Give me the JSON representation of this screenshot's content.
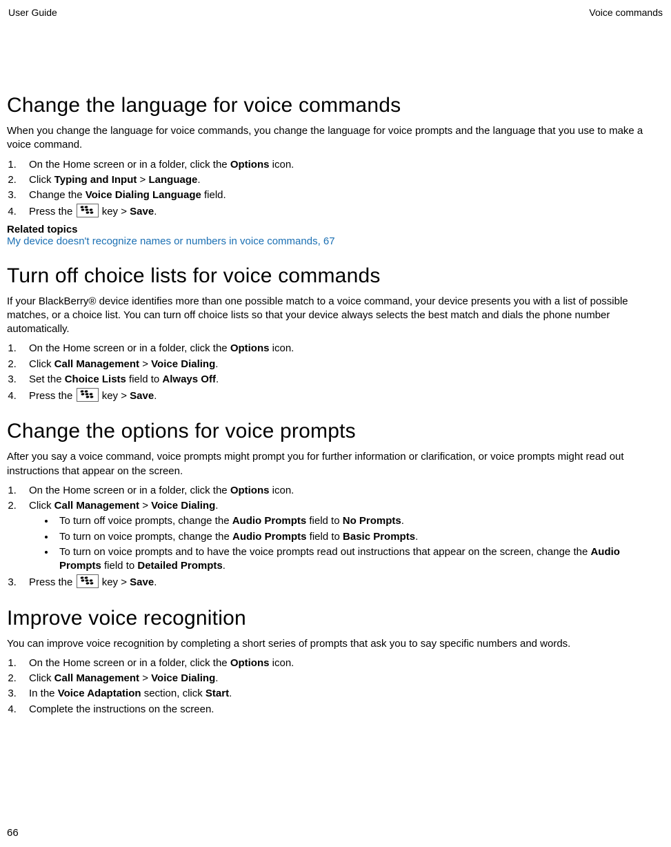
{
  "header": {
    "left": "User Guide",
    "right": "Voice commands"
  },
  "page_number": "66",
  "sections": {
    "s1": {
      "title": "Change the language for voice commands",
      "intro": "When you change the language for voice commands, you change the language for voice prompts and the language that you use to make a voice command.",
      "step1_a": "On the Home screen or in a folder, click the ",
      "step1_b": "Options",
      "step1_c": " icon.",
      "step2_a": "Click ",
      "step2_b": "Typing and Input",
      "step2_c": " > ",
      "step2_d": "Language",
      "step2_e": ".",
      "step3_a": "Change the ",
      "step3_b": "Voice Dialing Language",
      "step3_c": " field.",
      "step4_a": "Press the ",
      "step4_b": " key > ",
      "step4_c": "Save",
      "step4_d": ".",
      "related_label": "Related topics",
      "related_link": "My device doesn't recognize names or numbers in voice commands, 67"
    },
    "s2": {
      "title": "Turn off choice lists for voice commands",
      "intro": "If your BlackBerry® device identifies more than one possible match to a voice command, your device presents you with a list of possible matches, or a choice list. You can turn off choice lists so that your device always selects the best match and dials the phone number automatically.",
      "step1_a": "On the Home screen or in a folder, click the ",
      "step1_b": "Options",
      "step1_c": " icon.",
      "step2_a": "Click ",
      "step2_b": "Call Management",
      "step2_c": " > ",
      "step2_d": "Voice Dialing",
      "step2_e": ".",
      "step3_a": "Set the ",
      "step3_b": "Choice Lists",
      "step3_c": " field to ",
      "step3_d": "Always Off",
      "step3_e": ".",
      "step4_a": "Press the ",
      "step4_b": " key > ",
      "step4_c": "Save",
      "step4_d": "."
    },
    "s3": {
      "title": "Change the options for voice prompts",
      "intro": "After you say a voice command, voice prompts might prompt you for further information or clarification, or voice prompts might read out instructions that appear on the screen.",
      "step1_a": "On the Home screen or in a folder, click the ",
      "step1_b": "Options",
      "step1_c": " icon.",
      "step2_a": "Click ",
      "step2_b": "Call Management",
      "step2_c": " > ",
      "step2_d": "Voice Dialing",
      "step2_e": ".",
      "b1_a": "To turn off voice prompts, change the ",
      "b1_b": "Audio Prompts",
      "b1_c": " field to ",
      "b1_d": "No Prompts",
      "b1_e": ".",
      "b2_a": "To turn on voice prompts, change the ",
      "b2_b": "Audio Prompts",
      "b2_c": " field to ",
      "b2_d": "Basic Prompts",
      "b2_e": ".",
      "b3_a": "To turn on voice prompts and to have the voice prompts read out instructions that appear on the screen, change the ",
      "b3_b": "Audio Prompts",
      "b3_c": " field to ",
      "b3_d": "Detailed Prompts",
      "b3_e": ".",
      "step3_a": "Press the ",
      "step3_b": " key > ",
      "step3_c": "Save",
      "step3_d": "."
    },
    "s4": {
      "title": "Improve voice recognition",
      "intro": "You can improve voice recognition by completing a short series of prompts that ask you to say specific numbers and words.",
      "step1_a": "On the Home screen or in a folder, click the ",
      "step1_b": "Options",
      "step1_c": " icon.",
      "step2_a": "Click ",
      "step2_b": "Call Management",
      "step2_c": " > ",
      "step2_d": "Voice Dialing",
      "step2_e": ".",
      "step3_a": "In the ",
      "step3_b": "Voice Adaptation",
      "step3_c": " section, click ",
      "step3_d": "Start",
      "step3_e": ".",
      "step4": "Complete the instructions on the screen."
    }
  }
}
